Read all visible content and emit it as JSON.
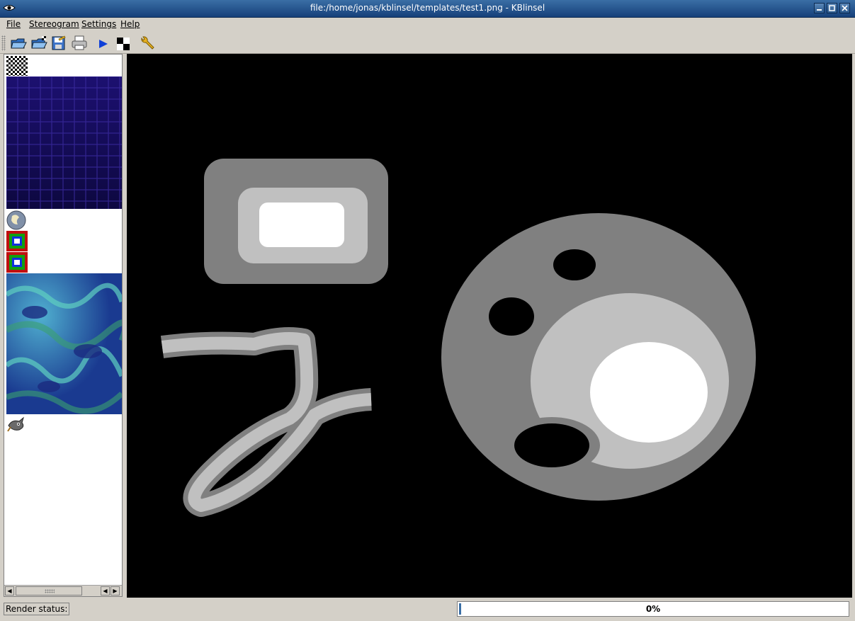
{
  "window": {
    "title": "file:/home/jonas/kblinsel/templates/test1.png - KBlinsel"
  },
  "menu": [
    {
      "label": "File"
    },
    {
      "label": "Stereogram"
    },
    {
      "label": "Settings"
    },
    {
      "label": "Help"
    }
  ],
  "toolbar": [
    {
      "icon": "open-folder-icon"
    },
    {
      "icon": "open-pattern-icon"
    },
    {
      "icon": "save-icon"
    },
    {
      "icon": "print-icon"
    },
    {
      "icon": "play-render-icon"
    },
    {
      "icon": "checker-pattern-icon"
    },
    {
      "icon": "wrench-settings-icon"
    }
  ],
  "status": {
    "label": "Render status:",
    "progress_text": "0%",
    "progress_value": 0.005
  },
  "colors": {
    "title_bar": "#2c5a8e",
    "canvas_bg": "#000000",
    "depth_dark": "#808080",
    "depth_mid": "#c0c0c0",
    "depth_light": "#ffffff"
  }
}
